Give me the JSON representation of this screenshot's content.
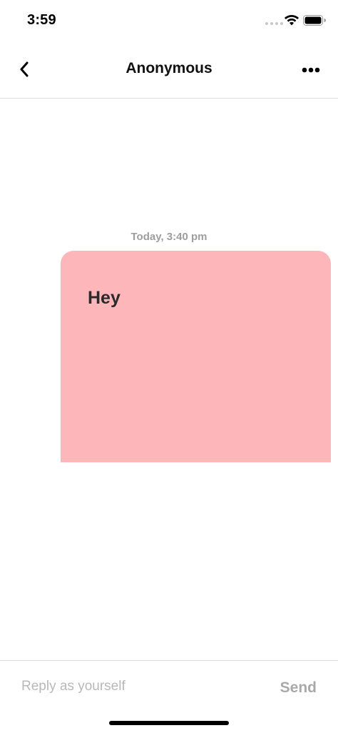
{
  "status_bar": {
    "time": "3:59",
    "icons": [
      "signal-dots-icon",
      "wifi-icon",
      "battery-icon"
    ]
  },
  "nav": {
    "title": "Anonymous",
    "back_icon": "chevron-left-icon",
    "more_icon": "more-horizontal-icon"
  },
  "thread": {
    "timestamp": "Today, 3:40 pm",
    "messages": [
      {
        "text": "Hey",
        "bubble_color": "#fdb7ba"
      }
    ]
  },
  "reply": {
    "placeholder": "Reply as yourself",
    "value": "",
    "send_label": "Send"
  },
  "colors": {
    "bubble": "#fdb7ba",
    "muted_text": "#9e9e9e",
    "divider": "#dcdcdc"
  }
}
